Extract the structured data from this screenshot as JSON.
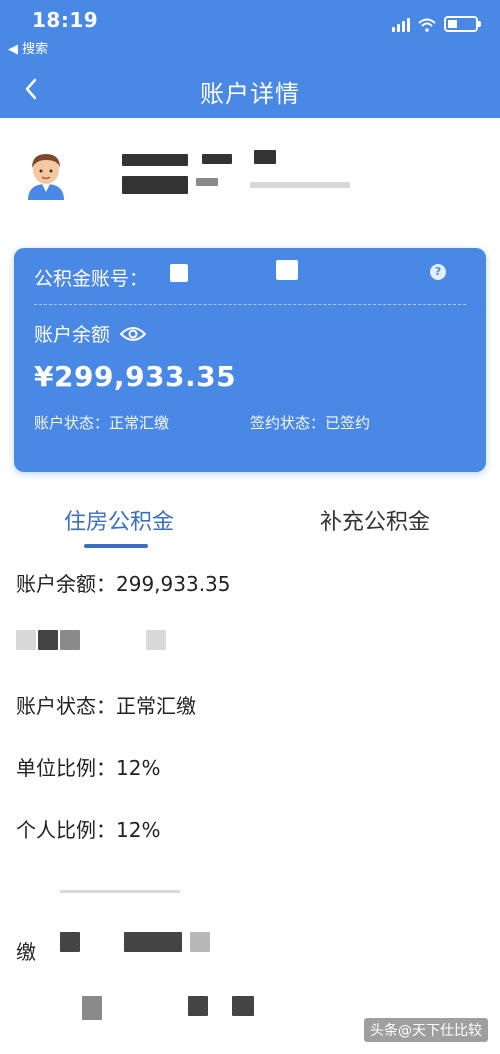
{
  "status_bar": {
    "time": "18:19",
    "back_app": "◀ 搜索"
  },
  "nav": {
    "title": "账户详情"
  },
  "card": {
    "account_label": "公积金账号：",
    "balance_label": "账户余额",
    "balance_amount": "¥299,933.35",
    "account_state": "账户状态：正常汇缴",
    "sign_state": "签约状态：已签约"
  },
  "tabs": {
    "housing": "住房公积金",
    "supplementary": "补充公积金"
  },
  "details": {
    "balance": "账户余额：299,933.35",
    "state": "账户状态：正常汇缴",
    "unit_ratio": "单位比例：12%",
    "personal_ratio": "个人比例：12%",
    "pay_prefix": "缴"
  },
  "watermark": "头条@天下仕比较",
  "colors": {
    "primary_blue": "#4a88e6",
    "tab_active": "#3a6fc0"
  },
  "icons": {
    "back": "chevron-left-icon",
    "eye": "eye-icon",
    "avatar": "avatar-icon"
  }
}
